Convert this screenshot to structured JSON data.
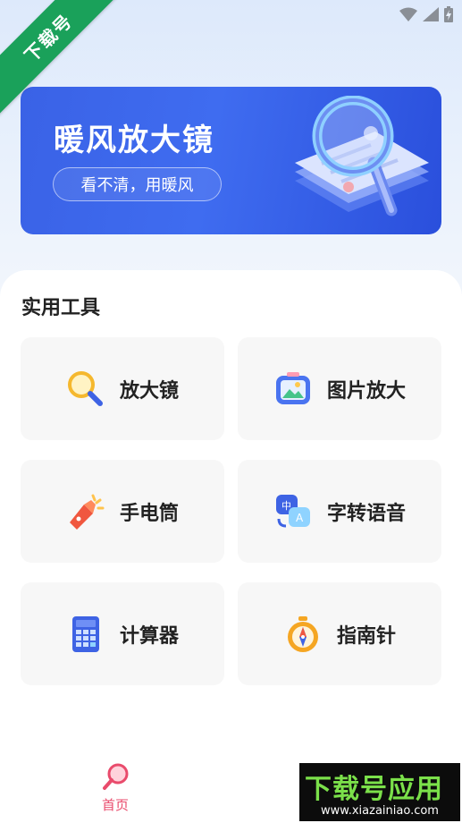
{
  "ribbon": {
    "text": "下载号"
  },
  "banner": {
    "title": "暖风放大镜",
    "slogan": "看不清，用暖风"
  },
  "section": {
    "title": "实用工具"
  },
  "tools": [
    {
      "label": "放大镜",
      "icon": "magnifier-icon"
    },
    {
      "label": "图片放大",
      "icon": "image-icon"
    },
    {
      "label": "手电筒",
      "icon": "flashlight-icon"
    },
    {
      "label": "字转语音",
      "icon": "translate-icon"
    },
    {
      "label": "计算器",
      "icon": "calculator-icon"
    },
    {
      "label": "指南针",
      "icon": "compass-icon"
    }
  ],
  "nav": {
    "home_label": "首页"
  },
  "watermark": {
    "title": "下载号应用",
    "url": "www.xiazainiao.com"
  },
  "colors": {
    "accent": "#e94b6c",
    "banner": "#3a62e6",
    "ribbon": "#1aa15a"
  }
}
